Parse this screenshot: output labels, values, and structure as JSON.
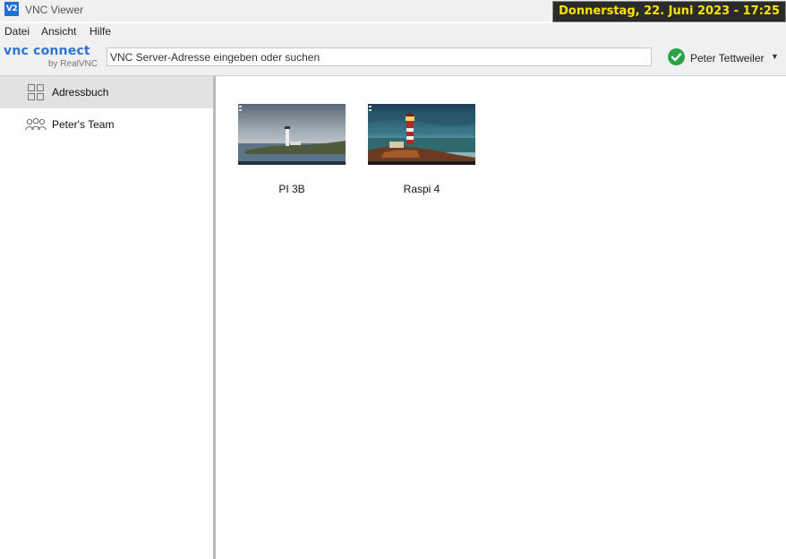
{
  "window": {
    "title": "VNC Viewer",
    "icon": "vnc-app-icon",
    "icon_text": "V2"
  },
  "overlay": {
    "datetime": "Donnerstag, 22. Juni 2023 - 17:25"
  },
  "menu": [
    "Datei",
    "Ansicht",
    "Hilfe"
  ],
  "toolbar": {
    "logo_main": "vnc connect",
    "logo_sub": "by RealVNC",
    "search_placeholder": "VNC Server-Adresse eingeben oder suchen",
    "user_name": "Peter Tettweiler",
    "user_status_icon": "check-circle-icon"
  },
  "sidebar": {
    "items": [
      {
        "label": "Adressbuch",
        "icon": "grid-icon",
        "active": true
      },
      {
        "label": "Peter's Team",
        "icon": "team-icon",
        "active": false
      }
    ]
  },
  "computers": [
    {
      "name": "PI 3B",
      "thumbnail": "lighthouse-grey-sea"
    },
    {
      "name": "Raspi 4",
      "thumbnail": "lighthouse-sunset"
    }
  ],
  "colors": {
    "accent": "#1e6fd9",
    "logo_blue": "#2b76d2",
    "status_green": "#2ca24a",
    "datetime_fg": "#ffe300",
    "datetime_bg": "#2b2b2b",
    "sidebar_active": "#e2e2e2"
  }
}
